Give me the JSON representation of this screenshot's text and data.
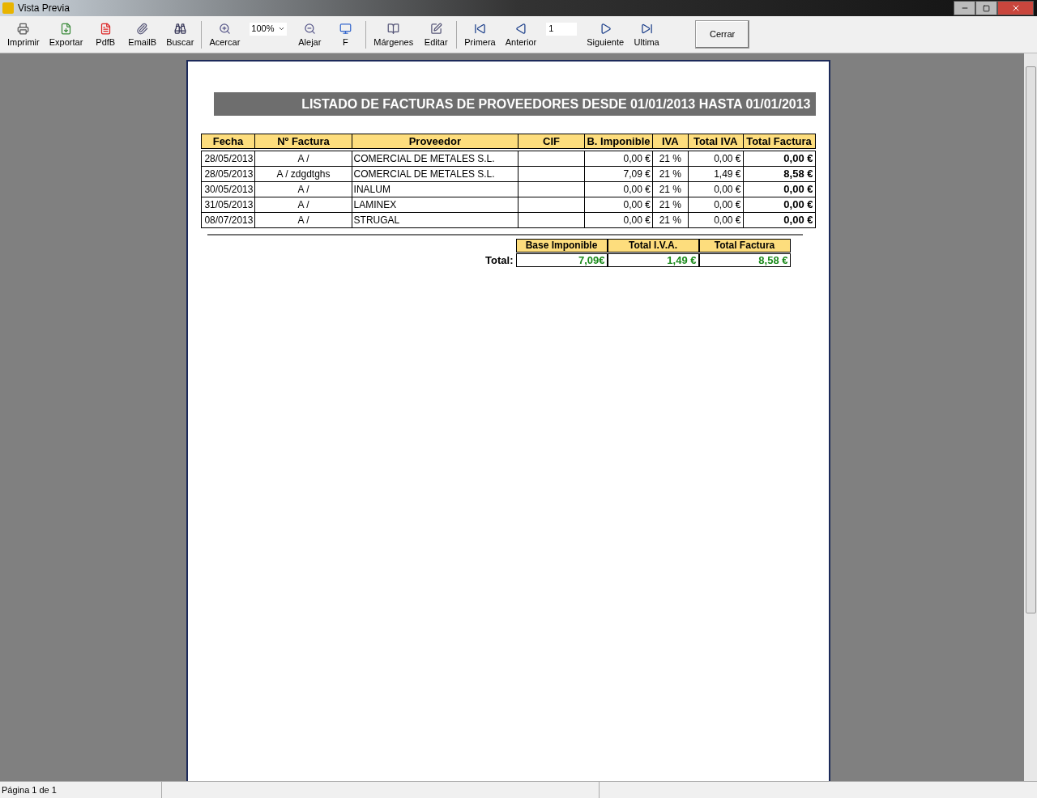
{
  "window": {
    "title": "Vista Previa"
  },
  "toolbar": [
    {
      "kind": "button",
      "label": "Imprimir"
    },
    {
      "kind": "button",
      "label": "Exportar"
    },
    {
      "kind": "button",
      "label": "PdfB"
    },
    {
      "kind": "button",
      "label": "EmailB"
    },
    {
      "kind": "button",
      "label": "Buscar"
    },
    {
      "kind": "separator"
    },
    {
      "kind": "button",
      "label": "Acercar"
    },
    {
      "kind": "zoom",
      "value": "100%"
    },
    {
      "kind": "button",
      "label": "Alejar"
    },
    {
      "kind": "button",
      "label": "F"
    },
    {
      "kind": "separator"
    },
    {
      "kind": "button",
      "label": "Márgenes"
    },
    {
      "kind": "button",
      "label": "Editar"
    },
    {
      "kind": "separator"
    },
    {
      "kind": "button",
      "label": "Primera"
    },
    {
      "kind": "button",
      "label": "Anterior"
    },
    {
      "kind": "page",
      "value": "1"
    },
    {
      "kind": "button",
      "label": "Siguiente"
    },
    {
      "kind": "button",
      "label": "Ultima"
    },
    {
      "kind": "close",
      "label": "Cerrar"
    }
  ],
  "report": {
    "title": "LISTADO DE FACTURAS DE PROVEEDORES DESDE 01/01/2013 HASTA 01/01/2013",
    "columns": [
      "Fecha",
      "Nº Factura",
      "Proveedor",
      "CIF",
      "B. Imponible",
      "IVA",
      "Total IVA",
      "Total Factura"
    ],
    "rows": [
      [
        "28/05/2013",
        "A /",
        "COMERCIAL DE METALES S.L.",
        "",
        "0,00 €",
        "21 %",
        "0,00 €",
        "0,00 €"
      ],
      [
        "28/05/2013",
        "A / zdgdtghs",
        "COMERCIAL DE METALES S.L.",
        "",
        "7,09 €",
        "21 %",
        "1,49 €",
        "8,58 €"
      ],
      [
        "30/05/2013",
        "A /",
        "INALUM",
        "",
        "0,00 €",
        "21 %",
        "0,00 €",
        "0,00 €"
      ],
      [
        "31/05/2013",
        "A /",
        "LAMINEX",
        "",
        "0,00 €",
        "21 %",
        "0,00 €",
        "0,00 €"
      ],
      [
        "08/07/2013",
        "A /",
        "STRUGAL",
        "",
        "0,00 €",
        "21 %",
        "0,00 €",
        "0,00 €"
      ]
    ],
    "totals": {
      "label": "Total:",
      "columns": [
        "Base Imponible",
        "Total I.V.A.",
        "Total Factura"
      ],
      "values": [
        "7,09€",
        "1,49 €",
        "8,58 €"
      ]
    }
  },
  "status_bar": [
    "Página 1 de 1"
  ]
}
